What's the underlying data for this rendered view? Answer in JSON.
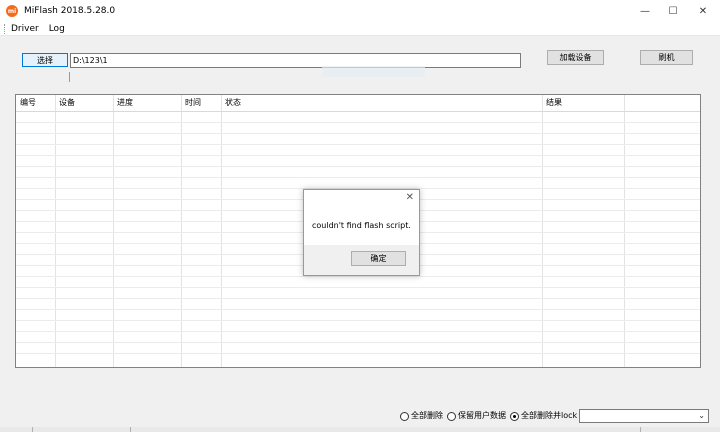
{
  "window": {
    "title": "MiFlash 2018.5.28.0",
    "icon_text": "mi",
    "minimize_glyph": "—",
    "maximize_glyph": "☐",
    "close_glyph": "✕"
  },
  "menu": {
    "items": [
      "Driver",
      "Log"
    ]
  },
  "toolbar": {
    "select_label": "选择",
    "path_value": "D:\\123\\1",
    "load_device_label": "加载设备",
    "flash_label": "刷机"
  },
  "table": {
    "columns": [
      "编号",
      "设备",
      "进度",
      "时间",
      "状态",
      "结果"
    ]
  },
  "dialog": {
    "close_glyph": "✕",
    "message": "couldn't find flash script.",
    "ok_label": "确定"
  },
  "options": {
    "radio_items": [
      {
        "label": "全部删除",
        "checked": false
      },
      {
        "label": "保留用户数据",
        "checked": false
      },
      {
        "label": "全部删除并lock",
        "checked": true
      }
    ],
    "select_value": "",
    "dropdown_glyph": "⌄"
  },
  "colors": {
    "accent": "#0078d7",
    "app_icon": "#f36b1c"
  }
}
